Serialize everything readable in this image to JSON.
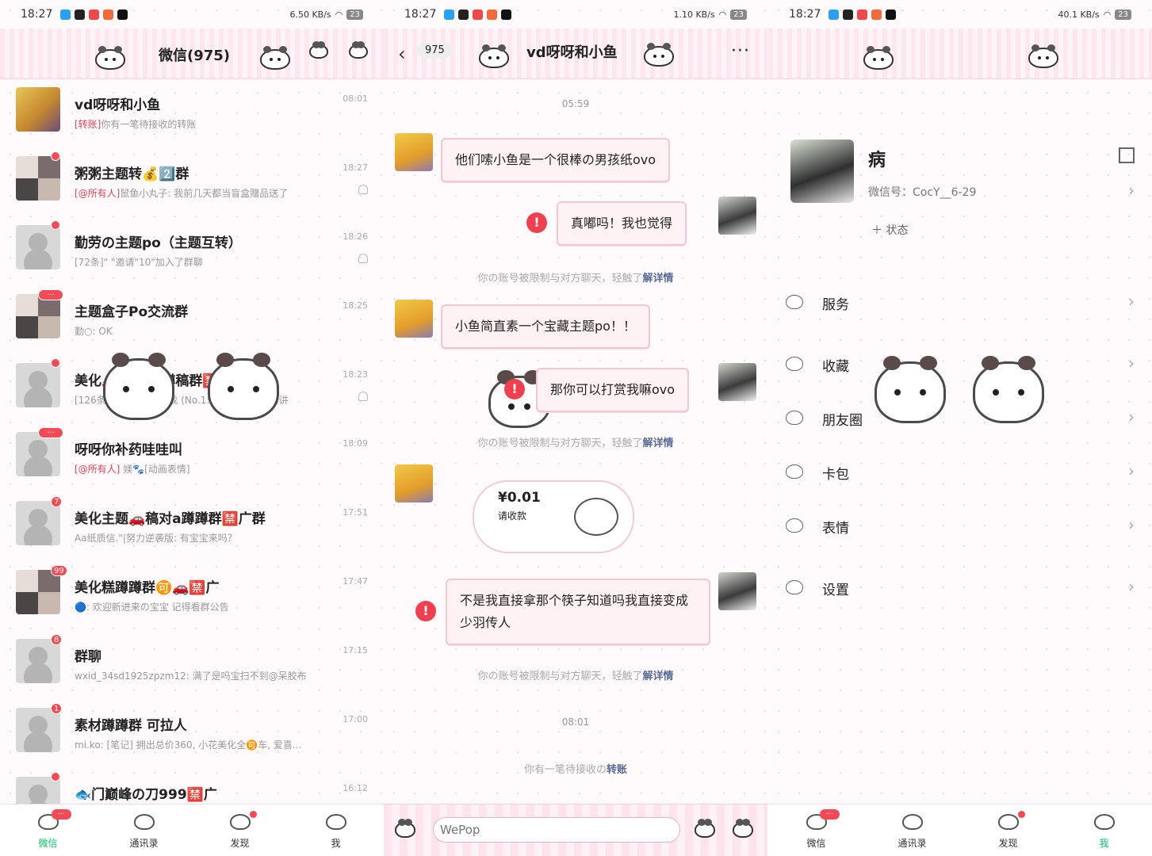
{
  "panels": {
    "chats": {
      "status": {
        "time": "18:27",
        "net": "6.50 KB/s",
        "battery": "23"
      },
      "title": "微信(975)",
      "chats": [
        {
          "name": "vd呀呀和小鱼",
          "time": "08:01",
          "preview_tag": "[转账]",
          "preview": "你有一笔待接收的转账",
          "badge": ""
        },
        {
          "name": "粥粥主题转💰2️⃣群",
          "time": "18:27",
          "preview_tag": "[@所有人]",
          "preview": "鼠鱼小丸子: 我前几天都当盲盒赠品送了",
          "badge": "dot"
        },
        {
          "name": "勤劳の主题po（主题互转）",
          "time": "18:26",
          "preview_tag": "",
          "preview": "[72条]\" \"邀请\"10\"加入了群聊",
          "badge": "dot"
        },
        {
          "name": "主题盒子Po交流群",
          "time": "18:25",
          "preview_tag": "",
          "preview": "勤○: OK",
          "badge": "···"
        },
        {
          "name": "美化🚗🚗主题蹲稿群🈲广",
          "time": "18:23",
          "preview_tag": "",
          "preview": "[126条] 轩🎀化视频a找 (No.1:2859) 你可以去讲",
          "badge": "dot"
        },
        {
          "name": "呀呀你补药哇哇叫",
          "time": "18:09",
          "preview_tag": "[@所有人]",
          "preview": " 媄🐾[动画表情]",
          "badge": "···"
        },
        {
          "name": "美化主题🚗稿对a蹲蹲群🈲广群",
          "time": "17:51",
          "preview_tag": "",
          "preview": "Aa纸质信.\"|努力逆袭版: 有宝宝来吗？",
          "badge": "7"
        },
        {
          "name": "美化糕蹲蹲群🉑🚗🈲广",
          "time": "17:47",
          "preview_tag": "",
          "preview": "🔵: 欢迎新进来の宝宝 记得看群公告",
          "badge": "99"
        },
        {
          "name": "群聊",
          "time": "17:15",
          "preview_tag": "",
          "preview": "wxid_34sd1925zpzm12: 满了是吗宝扫不到@呆胶布",
          "badge": "8"
        },
        {
          "name": "素材蹲蹲群 可拉人",
          "time": "17:00",
          "preview_tag": "",
          "preview": "mi.ko: [笔记] 拥出总价360, 小花美化全🉑车, 爱喜...",
          "badge": "1"
        },
        {
          "name": "🐟门巅峰の刀999🈲广",
          "time": "16:12",
          "preview_tag": "",
          "preview": "",
          "badge": "dot"
        }
      ]
    },
    "conversation": {
      "status": {
        "time": "18:27",
        "net": "1.10 KB/s",
        "battery": "23"
      },
      "unread": "975",
      "title": "vd呀呀和小鱼",
      "time1": "05:59",
      "msg1": "他们嗦小鱼是一个很棒の男孩纸ovo",
      "msg2": "真嘟吗！我也觉得",
      "sys_text": "你の账号被限制与对方聊天，轻触了",
      "sys_link": "解详情",
      "msg3": "小鱼简直素一个宝藏主题po！！",
      "msg4": "那你可以打赏我嘛ovo",
      "transfer_amount": "¥0.01",
      "transfer_label": "请收款",
      "msg5": "不是我直接拿那个筷子知道吗我直接变成少羽传人",
      "time2": "08:01",
      "pending_text": "你有一笔待接收の",
      "pending_link": "转账",
      "input_placeholder": "WePop"
    },
    "me": {
      "status": {
        "time": "18:27",
        "net": "40.1 KB/s",
        "battery": "23"
      },
      "name": "病",
      "wechat_id": "微信号：CocY__6-29",
      "status_add": "＋ 状态",
      "menu": [
        "服务",
        "收藏",
        "朋友圈",
        "卡包",
        "表情",
        "设置"
      ]
    }
  },
  "tabs": [
    {
      "label": "微信",
      "badge": "···"
    },
    {
      "label": "通讯录",
      "badge": ""
    },
    {
      "label": "发现",
      "badge": "dot"
    },
    {
      "label": "我",
      "badge": ""
    }
  ],
  "colors": {
    "accent_green": "#07c160",
    "badge_red": "#f44a56",
    "bubble_pink": "#fff2f5",
    "link_blue": "#576b95"
  }
}
